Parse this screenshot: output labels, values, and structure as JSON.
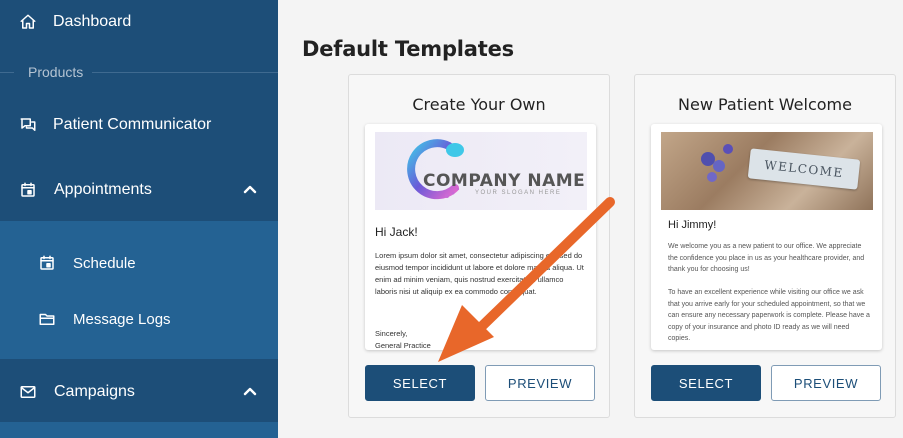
{
  "sidebar": {
    "dashboard": "Dashboard",
    "section_label": "Products",
    "patient_communicator": "Patient Communicator",
    "appointments": "Appointments",
    "schedule": "Schedule",
    "message_logs": "Message Logs",
    "campaigns": "Campaigns"
  },
  "main": {
    "title": "Default Templates",
    "cards": [
      {
        "title": "Create Your Own",
        "company_name": "COMPANY NAME",
        "slogan": "YOUR SLOGAN HERE",
        "greeting": "Hi Jack!",
        "body": "Lorem ipsum dolor sit amet, consectetur adipiscing elit, sed do eiusmod tempor incididunt ut labore et dolore magna aliqua. Ut enim ad minim veniam, quis nostrud exercitation ullamco laboris nisi ut aliquip ex ea commodo consequat.",
        "signoff": "Sincerely,",
        "signature": "General Practice",
        "select_label": "SELECT",
        "preview_label": "PREVIEW"
      },
      {
        "title": "New Patient Welcome",
        "photo_tag": "WELCOME",
        "greeting": "Hi Jimmy!",
        "body1": "We welcome you as a new patient to our office. We appreciate the confidence you place in us as your healthcare provider, and thank you for choosing us!",
        "body2": "To have an excellent experience while visiting our office we ask that you arrive early for your scheduled appointment, so that we can ensure any necessary paperwork is complete. Please have a copy of your insurance and photo ID ready as we will need copies.",
        "select_label": "SELECT",
        "preview_label": "PREVIEW"
      }
    ]
  },
  "colors": {
    "sidebar_bg": "#1d4e78",
    "subnav_bg": "#246293",
    "button_primary": "#1c4e78",
    "annotation_arrow": "#e8672a"
  }
}
